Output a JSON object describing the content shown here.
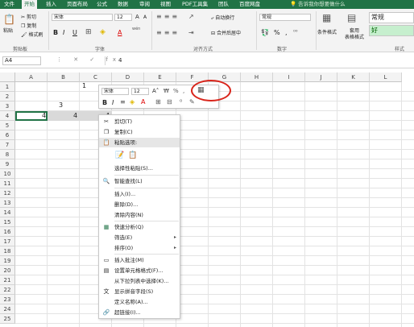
{
  "tabs": [
    "文件",
    "开始",
    "插入",
    "页面布局",
    "公式",
    "数据",
    "审阅",
    "视图",
    "PDF工具集",
    "团队",
    "百度网盘"
  ],
  "active_tab": "开始",
  "tell_me": "告诉我你想要做什么",
  "ribbon": {
    "clipboard": {
      "paste": "粘贴",
      "cut": "剪切",
      "copy": "复制",
      "format_painter": "格式刷",
      "label": "剪贴板"
    },
    "font": {
      "name": "宋体",
      "size": "12",
      "label": "字体",
      "bold": "B",
      "italic": "I",
      "underline": "U",
      "grow": "A",
      "shrink": "A",
      "wen": "wén",
      "font_color": "A"
    },
    "alignment": {
      "wrap": "自动换行",
      "merge": "合并后居中",
      "label": "对齐方式"
    },
    "number": {
      "format": "常规",
      "label": "数字",
      "percent": "%",
      "comma": ","
    },
    "styles": {
      "conditional": "条件格式",
      "table": "套用\n表格格式",
      "normal": "常规",
      "good": "好",
      "label": "样式"
    }
  },
  "formula_bar": {
    "name_box": "A4",
    "icons": "⋮ ✕ ✓ fx",
    "value": "4"
  },
  "columns": [
    "A",
    "B",
    "C",
    "D",
    "E",
    "F",
    "G",
    "H",
    "I",
    "J",
    "K",
    "L"
  ],
  "rows": [
    "1",
    "2",
    "3",
    "4",
    "5",
    "6",
    "7",
    "8",
    "9",
    "10",
    "11",
    "12",
    "13",
    "14",
    "15",
    "16",
    "17",
    "18",
    "19",
    "20",
    "21",
    "22",
    "23",
    "24",
    "25"
  ],
  "cells": {
    "b1": "1",
    "b3": "3",
    "a4": "4",
    "b4": "4",
    "c4": "4"
  },
  "mini_toolbar": {
    "font": "宋体",
    "size": "12",
    "bold": "B",
    "italic": "I"
  },
  "context_menu": [
    {
      "label": "剪切(T)",
      "icon": "scissors-icon",
      "glyph": "✂"
    },
    {
      "label": "复制(C)",
      "icon": "copy-icon",
      "glyph": "❐"
    },
    {
      "label": "粘贴选项:",
      "icon": "paste-icon",
      "glyph": "📋"
    },
    {
      "label": "选择性粘贴(S)...",
      "icon": "",
      "glyph": ""
    },
    {
      "label": "智能查找(L)",
      "icon": "search-icon",
      "glyph": "🔍"
    },
    {
      "label": "插入(I)...",
      "icon": "",
      "glyph": ""
    },
    {
      "label": "删除(D)...",
      "icon": "",
      "glyph": ""
    },
    {
      "label": "清除内容(N)",
      "icon": "",
      "glyph": ""
    },
    {
      "label": "快速分析(Q)",
      "icon": "quick-analysis-icon",
      "glyph": "▦"
    },
    {
      "label": "筛选(E)",
      "icon": "",
      "glyph": ""
    },
    {
      "label": "排序(O)",
      "icon": "",
      "glyph": ""
    },
    {
      "label": "插入批注(M)",
      "icon": "comment-icon",
      "glyph": "▭"
    },
    {
      "label": "设置单元格格式(F)...",
      "icon": "format-cells-icon",
      "glyph": "▤"
    },
    {
      "label": "从下拉列表中选择(K)...",
      "icon": "",
      "glyph": ""
    },
    {
      "label": "显示拼音字段(S)",
      "icon": "phonetic-icon",
      "glyph": "文"
    },
    {
      "label": "定义名称(A)...",
      "icon": "",
      "glyph": ""
    },
    {
      "label": "超链接(I)...",
      "icon": "hyperlink-icon",
      "glyph": "🔗"
    }
  ],
  "colors": {
    "brand": "#217346",
    "annotation": "#d9261c"
  }
}
